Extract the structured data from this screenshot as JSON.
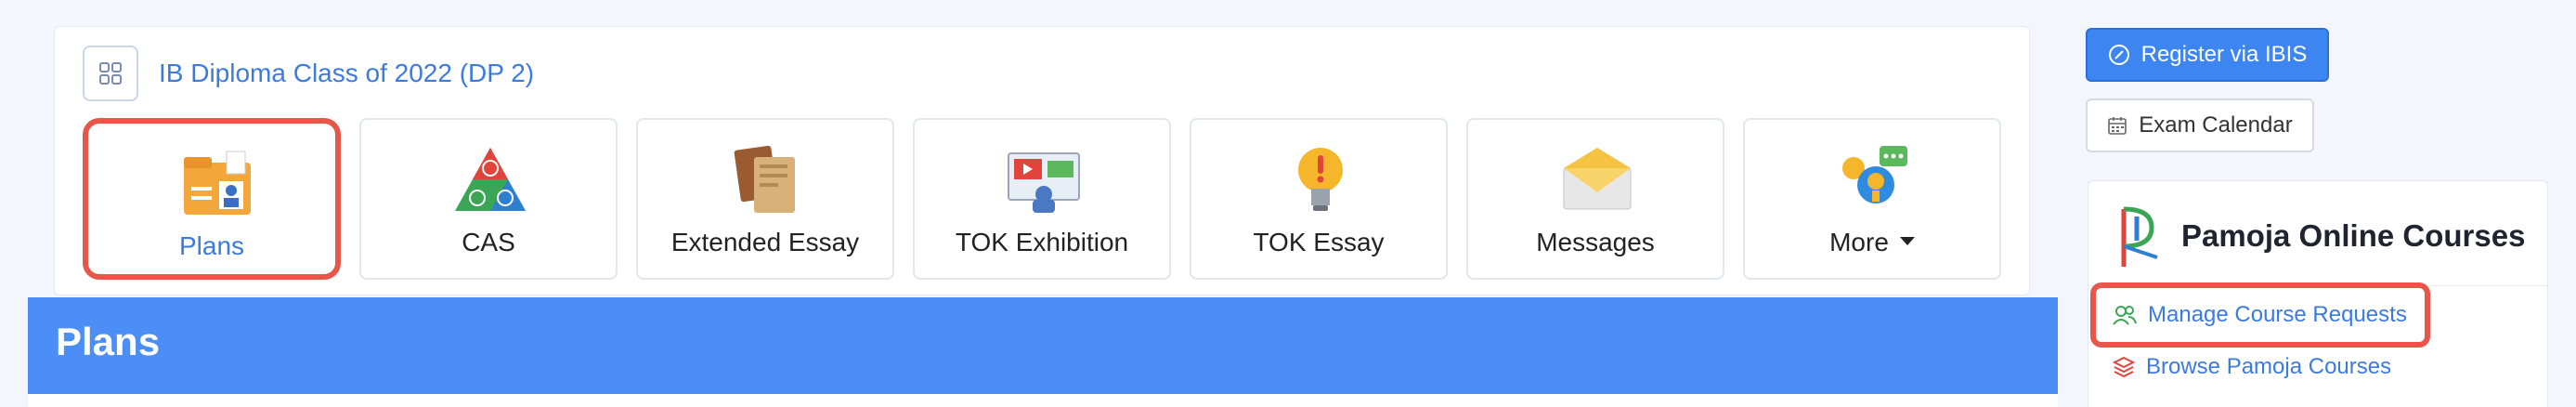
{
  "class_card": {
    "title": "IB Diploma Class of 2022 (DP 2)",
    "tiles": [
      {
        "label": "Plans",
        "icon": "plans-folder-icon",
        "active": true
      },
      {
        "label": "CAS",
        "icon": "cas-triangle-icon",
        "active": false
      },
      {
        "label": "Extended Essay",
        "icon": "books-icon",
        "active": false
      },
      {
        "label": "TOK Exhibition",
        "icon": "presentation-icon",
        "active": false
      },
      {
        "label": "TOK Essay",
        "icon": "lightbulb-icon",
        "active": false
      },
      {
        "label": "Messages",
        "icon": "envelope-icon",
        "active": false
      },
      {
        "label": "More",
        "icon": "chat-help-icon",
        "active": false
      }
    ]
  },
  "section": {
    "title": "Plans"
  },
  "sidebar": {
    "register_button": "Register via IBIS",
    "exam_button": "Exam Calendar",
    "pamoja": {
      "title": "Pamoja Online Courses",
      "links": [
        {
          "label": "Manage Course Requests",
          "icon": "users-icon"
        },
        {
          "label": "Browse Pamoja Courses",
          "icon": "layers-icon"
        }
      ]
    }
  },
  "colors": {
    "accent": "#3b7be0",
    "bar": "#4b8ef5",
    "highlight": "#e8564a"
  }
}
